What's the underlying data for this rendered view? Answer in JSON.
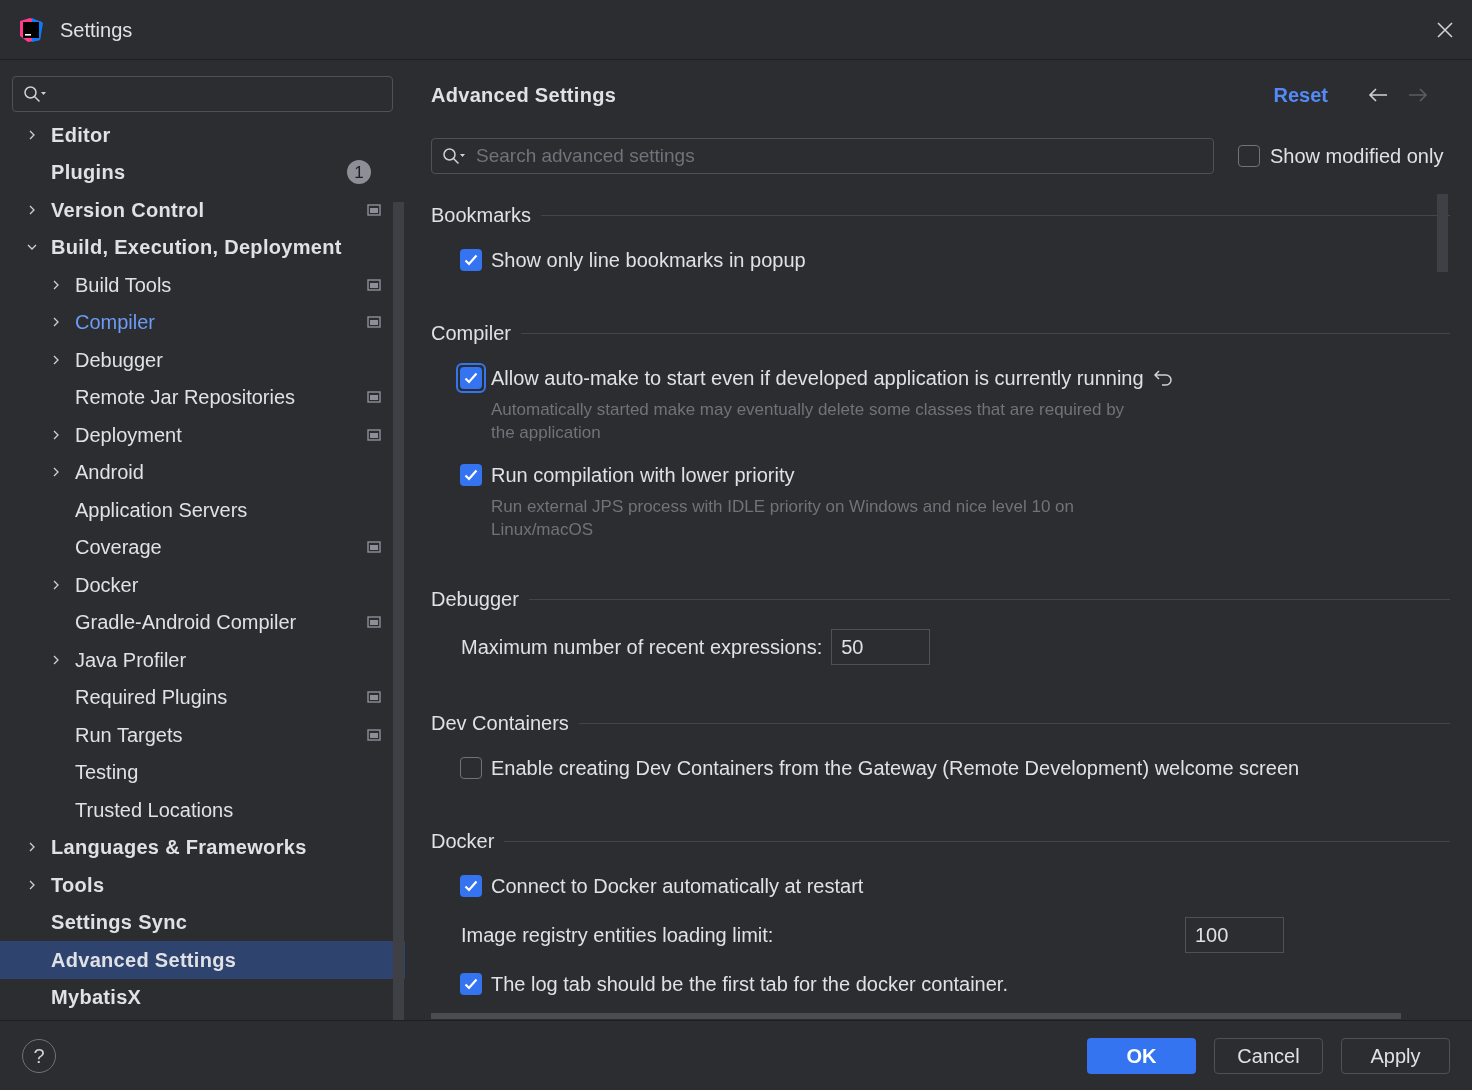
{
  "window": {
    "title": "Settings"
  },
  "sidebar": {
    "items": [
      {
        "label": "Editor",
        "expandable": true,
        "expanded": false,
        "selected": false,
        "modified": false,
        "project_scoped": false
      },
      {
        "label": "Plugins",
        "expandable": false,
        "selected": false,
        "modified": false,
        "project_scoped": false,
        "badge": "1"
      },
      {
        "label": "Version Control",
        "expandable": true,
        "expanded": false,
        "selected": false,
        "modified": false,
        "project_scoped": true
      },
      {
        "label": "Build, Execution, Deployment",
        "expandable": true,
        "expanded": true,
        "selected": false,
        "modified": false,
        "project_scoped": false,
        "children": [
          {
            "label": "Build Tools",
            "expandable": true,
            "expanded": false,
            "selected": false,
            "modified": false,
            "project_scoped": true
          },
          {
            "label": "Compiler",
            "expandable": true,
            "expanded": false,
            "selected": false,
            "modified": true,
            "project_scoped": true
          },
          {
            "label": "Debugger",
            "expandable": true,
            "expanded": false,
            "selected": false,
            "modified": false,
            "project_scoped": false
          },
          {
            "label": "Remote Jar Repositories",
            "expandable": false,
            "selected": false,
            "modified": false,
            "project_scoped": true
          },
          {
            "label": "Deployment",
            "expandable": true,
            "expanded": false,
            "selected": false,
            "modified": false,
            "project_scoped": true
          },
          {
            "label": "Android",
            "expandable": true,
            "expanded": false,
            "selected": false,
            "modified": false,
            "project_scoped": false
          },
          {
            "label": "Application Servers",
            "expandable": false,
            "selected": false,
            "modified": false,
            "project_scoped": false
          },
          {
            "label": "Coverage",
            "expandable": false,
            "selected": false,
            "modified": false,
            "project_scoped": true
          },
          {
            "label": "Docker",
            "expandable": true,
            "expanded": false,
            "selected": false,
            "modified": false,
            "project_scoped": false
          },
          {
            "label": "Gradle-Android Compiler",
            "expandable": false,
            "selected": false,
            "modified": false,
            "project_scoped": true
          },
          {
            "label": "Java Profiler",
            "expandable": true,
            "expanded": false,
            "selected": false,
            "modified": false,
            "project_scoped": false
          },
          {
            "label": "Required Plugins",
            "expandable": false,
            "selected": false,
            "modified": false,
            "project_scoped": true
          },
          {
            "label": "Run Targets",
            "expandable": false,
            "selected": false,
            "modified": false,
            "project_scoped": true
          },
          {
            "label": "Testing",
            "expandable": false,
            "selected": false,
            "modified": false,
            "project_scoped": false
          },
          {
            "label": "Trusted Locations",
            "expandable": false,
            "selected": false,
            "modified": false,
            "project_scoped": false
          }
        ]
      },
      {
        "label": "Languages & Frameworks",
        "expandable": true,
        "expanded": false,
        "selected": false,
        "modified": false,
        "project_scoped": false
      },
      {
        "label": "Tools",
        "expandable": true,
        "expanded": false,
        "selected": false,
        "modified": false,
        "project_scoped": false
      },
      {
        "label": "Settings Sync",
        "expandable": false,
        "selected": false,
        "modified": false,
        "project_scoped": false
      },
      {
        "label": "Advanced Settings",
        "expandable": false,
        "selected": true,
        "modified": false,
        "project_scoped": false
      },
      {
        "label": "MybatisX",
        "expandable": false,
        "selected": false,
        "modified": false,
        "project_scoped": false
      }
    ]
  },
  "main": {
    "title": "Advanced Settings",
    "reset": "Reset",
    "search": {
      "placeholder": "Search advanced settings"
    },
    "show_modified_only": {
      "label": "Show modified only",
      "checked": false
    },
    "sections": [
      {
        "title": "Bookmarks",
        "settings": [
          {
            "kind": "checkbox",
            "label": "Show only line bookmarks in popup",
            "checked": true,
            "modified": false,
            "focused": false
          }
        ]
      },
      {
        "title": "Compiler",
        "settings": [
          {
            "kind": "checkbox",
            "label": "Allow auto-make to start even if developed application is currently running",
            "checked": true,
            "modified": true,
            "focused": true,
            "description": "Automatically started make may eventually delete some classes that are required by the application"
          },
          {
            "kind": "checkbox",
            "label": "Run compilation with lower priority",
            "checked": true,
            "modified": false,
            "focused": false,
            "description": "Run external JPS process with IDLE priority on Windows and nice level 10 on Linux/macOS"
          }
        ]
      },
      {
        "title": "Debugger",
        "settings": [
          {
            "kind": "number",
            "label": "Maximum number of recent expressions:",
            "value": "50",
            "inline": true
          }
        ]
      },
      {
        "title": "Dev Containers",
        "settings": [
          {
            "kind": "checkbox",
            "label": "Enable creating Dev Containers from the Gateway (Remote Development) welcome screen",
            "checked": false,
            "modified": false,
            "focused": false
          }
        ]
      },
      {
        "title": "Docker",
        "settings": [
          {
            "kind": "checkbox",
            "label": "Connect to Docker automatically at restart",
            "checked": true,
            "modified": false,
            "focused": false
          },
          {
            "kind": "number",
            "label": "Image registry entities loading limit:",
            "value": "100",
            "inline": false
          },
          {
            "kind": "checkbox",
            "label": "The log tab should be the first tab for the docker container.",
            "checked": true,
            "modified": false,
            "focused": false
          }
        ]
      }
    ]
  },
  "footer": {
    "help": "?",
    "buttons": [
      {
        "label": "OK",
        "kind": "primary"
      },
      {
        "label": "Cancel",
        "kind": "secondary"
      },
      {
        "label": "Apply",
        "kind": "secondary"
      }
    ]
  }
}
